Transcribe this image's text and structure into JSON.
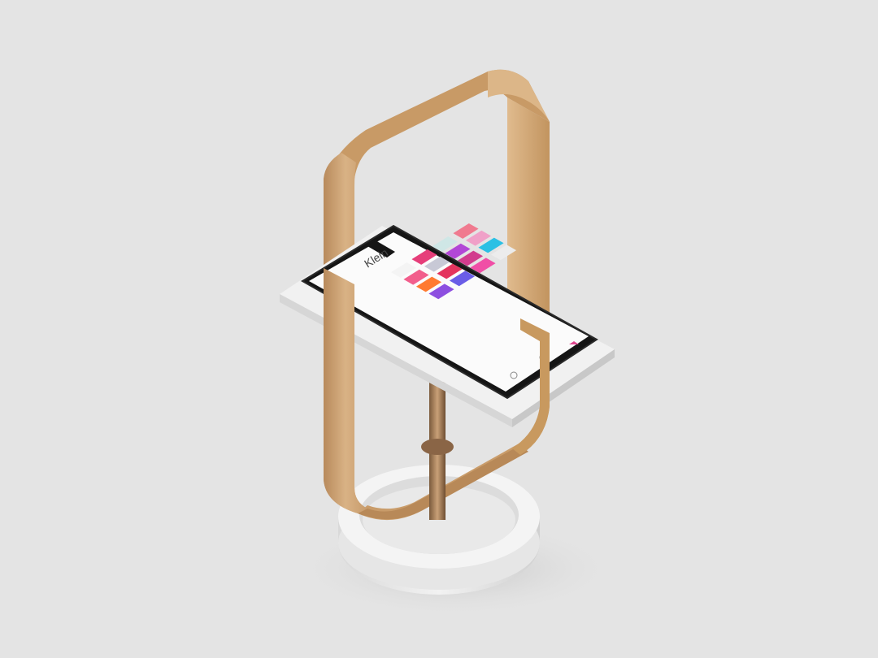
{
  "scene": {
    "background": "#e4e4e4",
    "stand_color": "#d1a97a",
    "marble_color": "#eeeeee",
    "phone_body_color": "#1a1a1a",
    "screen_color": "#fbfbfb"
  },
  "phone": {
    "profile_name": "Klein",
    "tabs": [
      "",
      "",
      ""
    ],
    "tile_colors": [
      [
        "#f4f4f4",
        "#e63e7a",
        "#cfe7e6",
        "#f07a8f"
      ],
      [
        "#f25e8c",
        "#c8c9d6",
        "#b247d6",
        "#f0a0c8"
      ],
      [
        "#ff7a30",
        "#e4345e",
        "#d23c8d",
        "#2bc0e4"
      ],
      [
        "#8d4fe0",
        "#6a5de7",
        "#f04ea6",
        "#ececec"
      ]
    ],
    "nav_icons": [
      "home-icon",
      "search-icon",
      "profile-icon"
    ]
  }
}
